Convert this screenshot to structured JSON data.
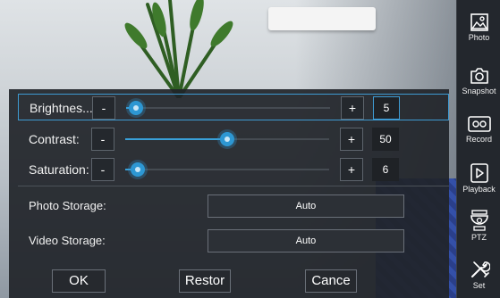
{
  "adjustments": [
    {
      "label": "Brightnes...",
      "minus": "-",
      "plus": "+",
      "value": "5",
      "level": 0.05
    },
    {
      "label": "Contrast:",
      "minus": "-",
      "plus": "+",
      "value": "50",
      "level": 0.5
    },
    {
      "label": "Saturation:",
      "minus": "-",
      "plus": "+",
      "value": "6",
      "level": 0.06
    }
  ],
  "storage": {
    "photo_label": "Photo Storage:",
    "photo_value": "Auto",
    "video_label": "Video Storage:",
    "video_value": "Auto"
  },
  "actions": {
    "ok": "OK",
    "restore": "Restor",
    "cancel": "Cance"
  },
  "sidebar": [
    {
      "label": "Photo",
      "icon": "photo-icon"
    },
    {
      "label": "Snapshot",
      "icon": "camera-icon"
    },
    {
      "label": "Record",
      "icon": "record-icon"
    },
    {
      "label": "Playback",
      "icon": "play-icon"
    },
    {
      "label": "PTZ",
      "icon": "ptz-camera-icon"
    },
    {
      "label": "Set",
      "icon": "tools-icon"
    }
  ],
  "colors": {
    "accent": "#2d97d3",
    "panel": "#212429",
    "sidebar": "#23272d"
  }
}
